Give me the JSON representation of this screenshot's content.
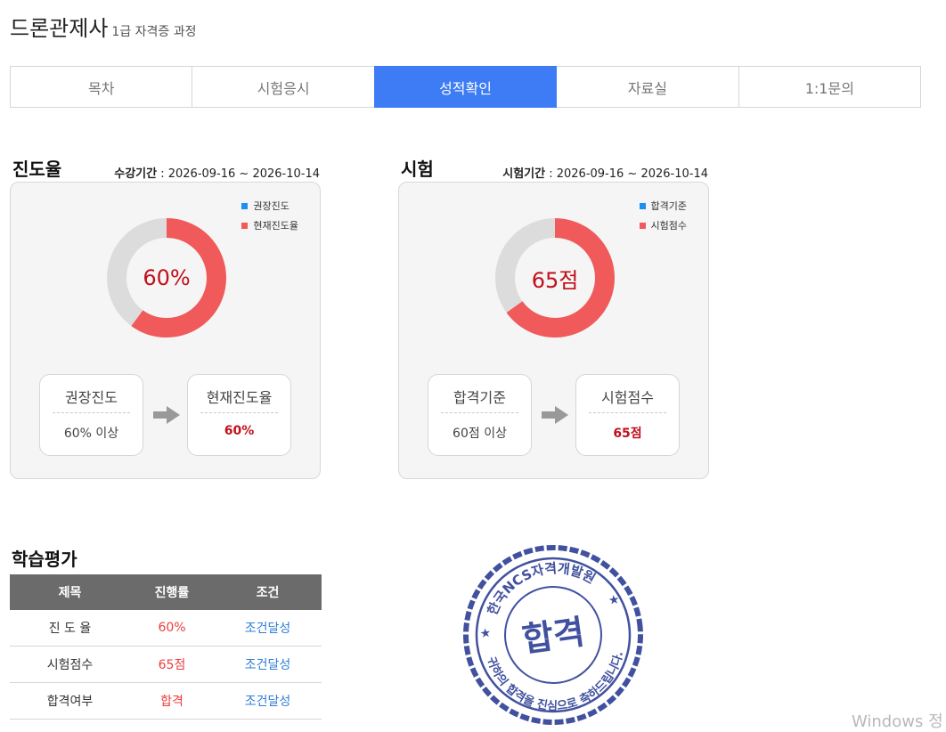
{
  "page": {
    "title": "드론관제사",
    "subtitle": "1급 자격증 과정"
  },
  "tabs": [
    {
      "label": "목차",
      "active": false
    },
    {
      "label": "시험응시",
      "active": false
    },
    {
      "label": "성적확인",
      "active": true
    },
    {
      "label": "자료실",
      "active": false
    },
    {
      "label": "1:1문의",
      "active": false
    }
  ],
  "progress": {
    "title": "진도율",
    "period_label": "수강기간",
    "period_value": " : 2026-09-16 ~ 2026-10-14",
    "legend": [
      {
        "label": "권장진도",
        "color": "#1e8ef0"
      },
      {
        "label": "현재진도율",
        "color": "#f05a5a"
      }
    ],
    "donut_value": 0.6,
    "donut_text": "60%",
    "left_box": {
      "title": "권장진도",
      "value": "60% 이상"
    },
    "right_box": {
      "title": "현재진도율",
      "value": "60%"
    }
  },
  "exam": {
    "title": "시험",
    "period_label": "시험기간",
    "period_value": " : 2026-09-16 ~ 2026-10-14",
    "legend": [
      {
        "label": "합격기준",
        "color": "#1e8ef0"
      },
      {
        "label": "시험점수",
        "color": "#f05a5a"
      }
    ],
    "donut_value": 0.65,
    "donut_text": "65점",
    "left_box": {
      "title": "합격기준",
      "value": "60점 이상"
    },
    "right_box": {
      "title": "시험점수",
      "value": "65점"
    }
  },
  "evaluation": {
    "title": "학습평가",
    "headers": [
      "제목",
      "진행률",
      "조건"
    ],
    "rows": [
      {
        "name": "진 도 율",
        "value": "60%",
        "condition": "조건달성"
      },
      {
        "name": "시험점수",
        "value": "65점",
        "condition": "조건달성"
      },
      {
        "name": "합격여부",
        "value": "합격",
        "condition": "조건달성"
      }
    ]
  },
  "stamp": {
    "top_text": "한국NCS자격개발원",
    "center_text": "합격",
    "bottom_text": "귀하의 합격을 진심으로 축하드립니다."
  },
  "os_watermark": "Windows 정"
}
